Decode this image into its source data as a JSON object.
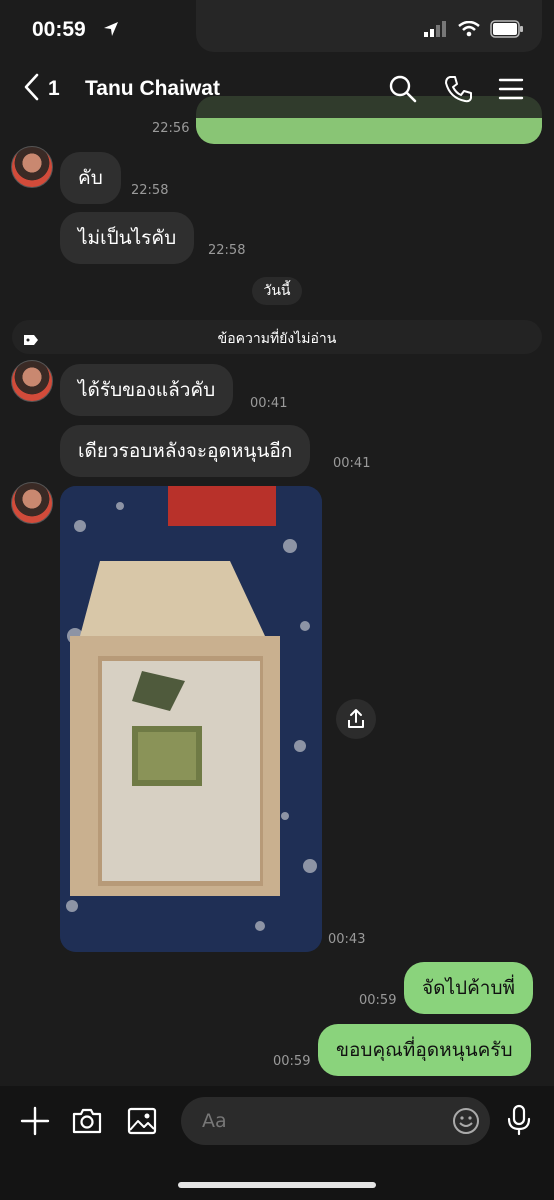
{
  "status_bar": {
    "time": "00:59"
  },
  "header": {
    "back_count": "1",
    "contact_name": "Tanu Chaiwat"
  },
  "messages": [
    {
      "text": "คับ",
      "time": "22:58"
    },
    {
      "text": "ไม่เป็นไรคับ",
      "time": "22:58"
    },
    {
      "text": "ได้รับของแล้วคับ",
      "time": "00:41"
    },
    {
      "text": "เดียวรอบหลังจะอุดหนุนอีก",
      "time": "00:41"
    },
    {
      "text": "จัดไปค้าบพี่",
      "time": "00:59"
    },
    {
      "text": "ขอบคุณที่อุดหนุนครับ",
      "time": "00:59"
    }
  ],
  "earlier_time": "22:56",
  "photo_time": "00:43",
  "date_separator": "วันนี้",
  "unread_label": "ข้อความที่ยังไม่อ่าน",
  "input": {
    "placeholder": "Aa"
  },
  "colors": {
    "my_bubble": "#8ad37c",
    "their_bubble": "#2f2f2f",
    "background": "#1c1c1c"
  },
  "icons": [
    "back-icon",
    "search-icon",
    "phone-icon",
    "menu-icon",
    "share-icon",
    "plus-icon",
    "camera-icon",
    "image-icon",
    "emoji-icon",
    "mic-icon"
  ]
}
